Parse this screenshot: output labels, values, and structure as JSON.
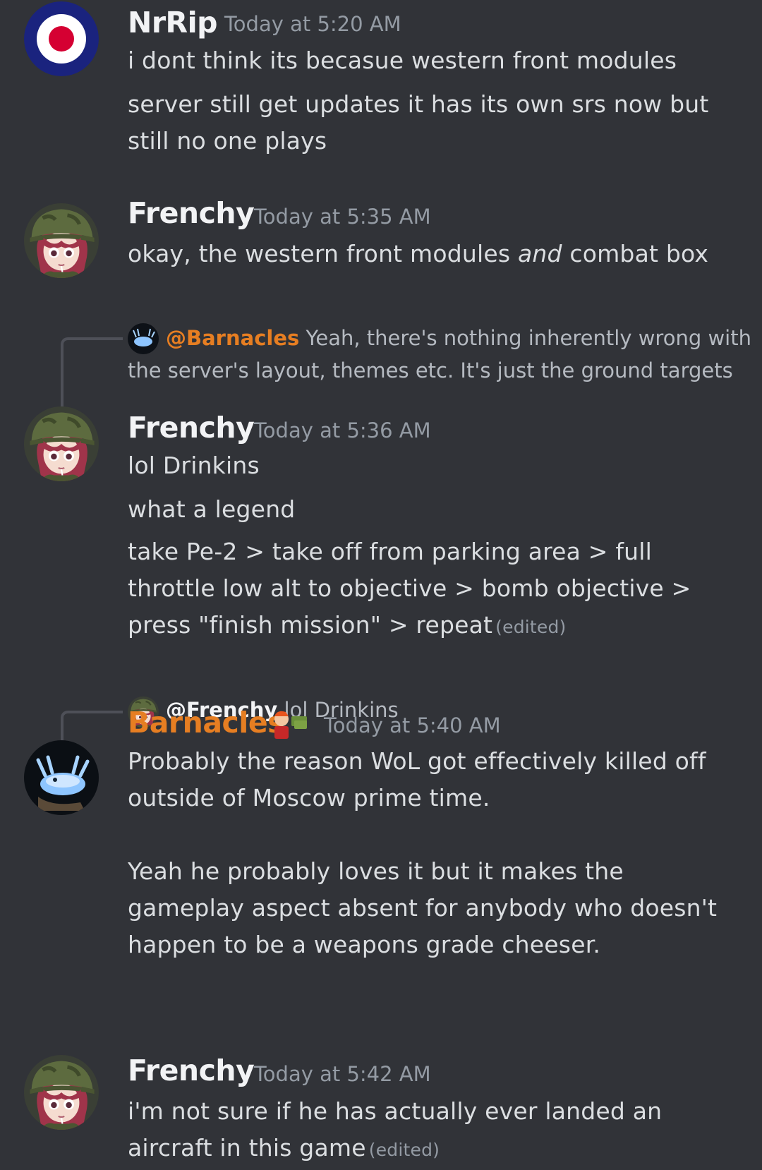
{
  "colors": {
    "background": "#313338",
    "text": "#dbdee1",
    "muted": "#949ba4",
    "username": "#f2f3f5",
    "barnacles_role": "#e67e22",
    "roundel_blue": "#1a237e",
    "roundel_red": "#d50032"
  },
  "messages": [
    {
      "username": "NrRip",
      "timestamp": "Today at 5:20 AM",
      "avatar_icon": "raf-roundel-avatar",
      "lines": [
        "i dont think its becasue western front modules",
        "server still get updates it has its own srs  now but",
        "still no one plays"
      ]
    },
    {
      "username": "Frenchy",
      "timestamp": "Today at 5:35 AM",
      "avatar_icon": "helmet-girl-avatar",
      "line_before": "okay, the western front modules ",
      "line_em": "and",
      "line_after": " combat box"
    },
    {
      "reply": {
        "mention": "@Barnacles",
        "text_first": " Yeah, there's nothing inherently wrong with",
        "text_second": "the server's layout, themes etc. It's just the ground targets"
      },
      "username": "Frenchy",
      "timestamp": "Today at 5:36 AM",
      "avatar_icon": "helmet-girl-avatar",
      "lines": [
        "lol Drinkins",
        "what a legend",
        "take Pe-2 > take off from parking area > full",
        "throttle low alt to objective > bomb objective >",
        "press \"finish mission\" > repeat"
      ],
      "edited": "(edited)"
    },
    {
      "reply": {
        "mention": "@Frenchy",
        "text_first": " lol Drinkins"
      },
      "username": "Barnacles",
      "timestamp": "Today at 5:40 AM",
      "avatar_icon": "blue-sea-slug-avatar",
      "badge_icon": "fry-money-emoji-badge",
      "lines": [
        "Probably the reason WoL got effectively killed off",
        "outside of Moscow prime time.",
        "",
        "Yeah he probably loves it but it makes the",
        "gameplay aspect absent for anybody who doesn't",
        "happen to be a weapons grade cheeser."
      ]
    },
    {
      "username": "Frenchy",
      "timestamp": "Today at 5:42 AM",
      "avatar_icon": "helmet-girl-avatar",
      "lines": [
        "i'm not sure if he has actually ever landed an",
        "aircraft in this game"
      ],
      "edited": "(edited)"
    }
  ]
}
